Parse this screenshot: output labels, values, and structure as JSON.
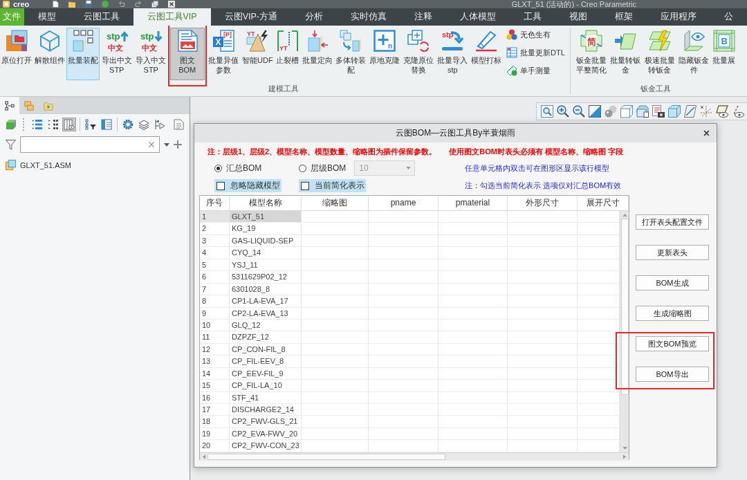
{
  "app": {
    "logo": "creo",
    "title": "GLXT_51 (活动的) - Creo Parametric"
  },
  "tabs": [
    {
      "label": "文件",
      "kind": "file",
      "selected": false
    },
    {
      "label": "模型",
      "kind": "tab",
      "selected": false
    },
    {
      "label": "云图工具",
      "kind": "tab",
      "selected": false
    },
    {
      "label": "云图工具VIP",
      "kind": "tab",
      "selected": true
    },
    {
      "label": "云图VIP-方通",
      "kind": "tab",
      "selected": false
    },
    {
      "label": "分析",
      "kind": "tab",
      "selected": false
    },
    {
      "label": "实时仿真",
      "kind": "tab",
      "selected": false
    },
    {
      "label": "注释",
      "kind": "tab",
      "selected": false
    },
    {
      "label": "人体模型",
      "kind": "tab",
      "selected": false
    },
    {
      "label": "工具",
      "kind": "tab",
      "selected": false
    },
    {
      "label": "视图",
      "kind": "tab",
      "selected": false
    },
    {
      "label": "框架",
      "kind": "tab",
      "selected": false
    },
    {
      "label": "应用程序",
      "kind": "tab",
      "selected": false
    },
    {
      "label": "公",
      "kind": "tab",
      "selected": false
    }
  ],
  "ribbon": {
    "groups": [
      {
        "label": "建模工具",
        "items": [
          {
            "label": "原位打开",
            "hovered": false,
            "pressed": false,
            "highlighted": false
          },
          {
            "label": "解散组件",
            "hovered": false,
            "pressed": false,
            "highlighted": false
          },
          {
            "label": "批量装配",
            "hovered": true,
            "pressed": false,
            "highlighted": false
          },
          {
            "label": "导出中文STP",
            "hovered": false,
            "pressed": false,
            "highlighted": false,
            "icon_text": [
              "stp",
              "中文"
            ]
          },
          {
            "label": "导入中文STP",
            "hovered": false,
            "pressed": false,
            "highlighted": false,
            "icon_text": [
              "stp",
              "中文"
            ]
          },
          {
            "label": "图文BOM",
            "hovered": false,
            "pressed": true,
            "highlighted": true
          },
          {
            "label": "批量异值参数",
            "hovered": false,
            "pressed": false,
            "highlighted": false,
            "icon_text": [
              "X",
              "[P]"
            ]
          },
          {
            "label": "智能UDF",
            "hovered": false,
            "pressed": false,
            "highlighted": false,
            "icon_text": [
              "YT"
            ]
          },
          {
            "label": "止裂槽",
            "hovered": false,
            "pressed": false,
            "highlighted": false,
            "icon_text": [
              "YT"
            ]
          },
          {
            "label": "批量定向",
            "hovered": false,
            "pressed": false,
            "highlighted": false
          },
          {
            "label": "多体转装配",
            "hovered": false,
            "pressed": false,
            "highlighted": false
          },
          {
            "label": "原地克隆",
            "hovered": false,
            "pressed": false,
            "highlighted": false,
            "icon_text": [
              "n"
            ]
          },
          {
            "label": "克隆原位替换",
            "hovered": false,
            "pressed": false,
            "highlighted": false
          },
          {
            "label": "批量导入stp",
            "hovered": false,
            "pressed": false,
            "highlighted": false,
            "icon_text": [
              "stp"
            ]
          },
          {
            "label": "模型打标",
            "hovered": false,
            "pressed": false,
            "highlighted": false
          }
        ],
        "small_items": [
          {
            "label": "无色生有"
          },
          {
            "label": "批量更新DTL"
          },
          {
            "label": "单手测量"
          }
        ]
      },
      {
        "label": "钣金工具",
        "items": [
          {
            "label": "钣金批量平整简化",
            "hovered": false,
            "pressed": false,
            "highlighted": false,
            "icon_text": [
              "简"
            ]
          },
          {
            "label": "批量转钣金",
            "hovered": false,
            "pressed": false,
            "highlighted": false
          },
          {
            "label": "极速批量转钣金",
            "hovered": false,
            "pressed": false,
            "highlighted": false
          },
          {
            "label": "隐藏钣金件",
            "hovered": false,
            "pressed": false,
            "highlighted": false
          },
          {
            "label": "批量展",
            "hovered": false,
            "pressed": false,
            "highlighted": false,
            "icon_text": [
              "B"
            ]
          }
        ]
      }
    ]
  },
  "model_tree": {
    "tabs": [
      {
        "selected": true
      },
      {
        "selected": false
      },
      {
        "selected": false
      }
    ],
    "tools": [
      {
        "pressed": false
      },
      {
        "pressed": false
      },
      {
        "pressed": false
      },
      {
        "pressed": true
      },
      {
        "pressed": false
      },
      {
        "pressed": false
      },
      {
        "pressed": false
      },
      {
        "pressed": false
      },
      {
        "pressed": false
      },
      {
        "pressed": false
      }
    ],
    "items": [
      {
        "label": "GLXT_51.ASM"
      }
    ]
  },
  "dialog": {
    "title": "云图BOM—云图工具By半蓑烟雨",
    "close": "×",
    "notes": [
      "注：层级1、层级2、模型名称、模型数量、缩略图为插件保留参数。",
      "使用图文BOM时表头必须有 模型名称、缩略图 字段"
    ],
    "modes": [
      {
        "label": "汇总BOM",
        "selected": true
      },
      {
        "label": "层级BOM",
        "selected": false
      }
    ],
    "level": {
      "value": "10",
      "disabled": true
    },
    "options": [
      {
        "label": "忽略隐藏模型",
        "checked": false,
        "focused": true
      },
      {
        "label": "当前简化表示",
        "checked": false,
        "focused": true
      }
    ],
    "hints": [
      "任意单元格内双击可在图形区显示该行模型",
      "注：勾选当前简化表示 选项仅对汇总BOM有效"
    ],
    "table": {
      "columns": [
        "序号",
        "模型名称",
        "缩略图",
        "pname",
        "pmaterial",
        "外形尺寸",
        "展开尺寸"
      ],
      "rows": [
        {
          "cells": [
            "1",
            "GLXT_51"
          ],
          "selected": true
        },
        {
          "cells": [
            "2",
            "KG_19"
          ],
          "selected": false
        },
        {
          "cells": [
            "3",
            "GAS-LIQUID-SEP"
          ],
          "selected": false
        },
        {
          "cells": [
            "4",
            "CYQ_14"
          ],
          "selected": false
        },
        {
          "cells": [
            "5",
            "YSJ_11"
          ],
          "selected": false
        },
        {
          "cells": [
            "6",
            "5311629P02_12"
          ],
          "selected": false
        },
        {
          "cells": [
            "7",
            "6301028_8"
          ],
          "selected": false
        },
        {
          "cells": [
            "8",
            "CP1-LA-EVA_17"
          ],
          "selected": false
        },
        {
          "cells": [
            "9",
            "CP2-LA-EVA_13"
          ],
          "selected": false
        },
        {
          "cells": [
            "10",
            "GLQ_12"
          ],
          "selected": false
        },
        {
          "cells": [
            "11",
            "DZPZF_12"
          ],
          "selected": false
        },
        {
          "cells": [
            "12",
            "CP_CON-FIL_8"
          ],
          "selected": false
        },
        {
          "cells": [
            "13",
            "CP_FIL-EEV_8"
          ],
          "selected": false
        },
        {
          "cells": [
            "14",
            "CP_EEV-FIL_9"
          ],
          "selected": false
        },
        {
          "cells": [
            "15",
            "CP_FIL-LA_10"
          ],
          "selected": false
        },
        {
          "cells": [
            "16",
            "STF_41"
          ],
          "selected": false
        },
        {
          "cells": [
            "17",
            "DISCHARGE2_14"
          ],
          "selected": false
        },
        {
          "cells": [
            "18",
            "CP2_FWV-GLS_21"
          ],
          "selected": false
        },
        {
          "cells": [
            "19",
            "CP2_EVA-FWV_20"
          ],
          "selected": false
        },
        {
          "cells": [
            "20",
            "CP2_FWV-CON_23"
          ],
          "selected": false
        }
      ]
    },
    "buttons": [
      {
        "label": "打开表头配置文件",
        "highlighted": false
      },
      {
        "label": "更新表头",
        "highlighted": false
      },
      {
        "label": "BOM生成",
        "highlighted": false
      },
      {
        "label": "生成缩略图",
        "highlighted": false
      },
      {
        "label": "图文BOM预览",
        "highlighted": true
      },
      {
        "label": "BOM导出",
        "highlighted": true
      }
    ]
  }
}
